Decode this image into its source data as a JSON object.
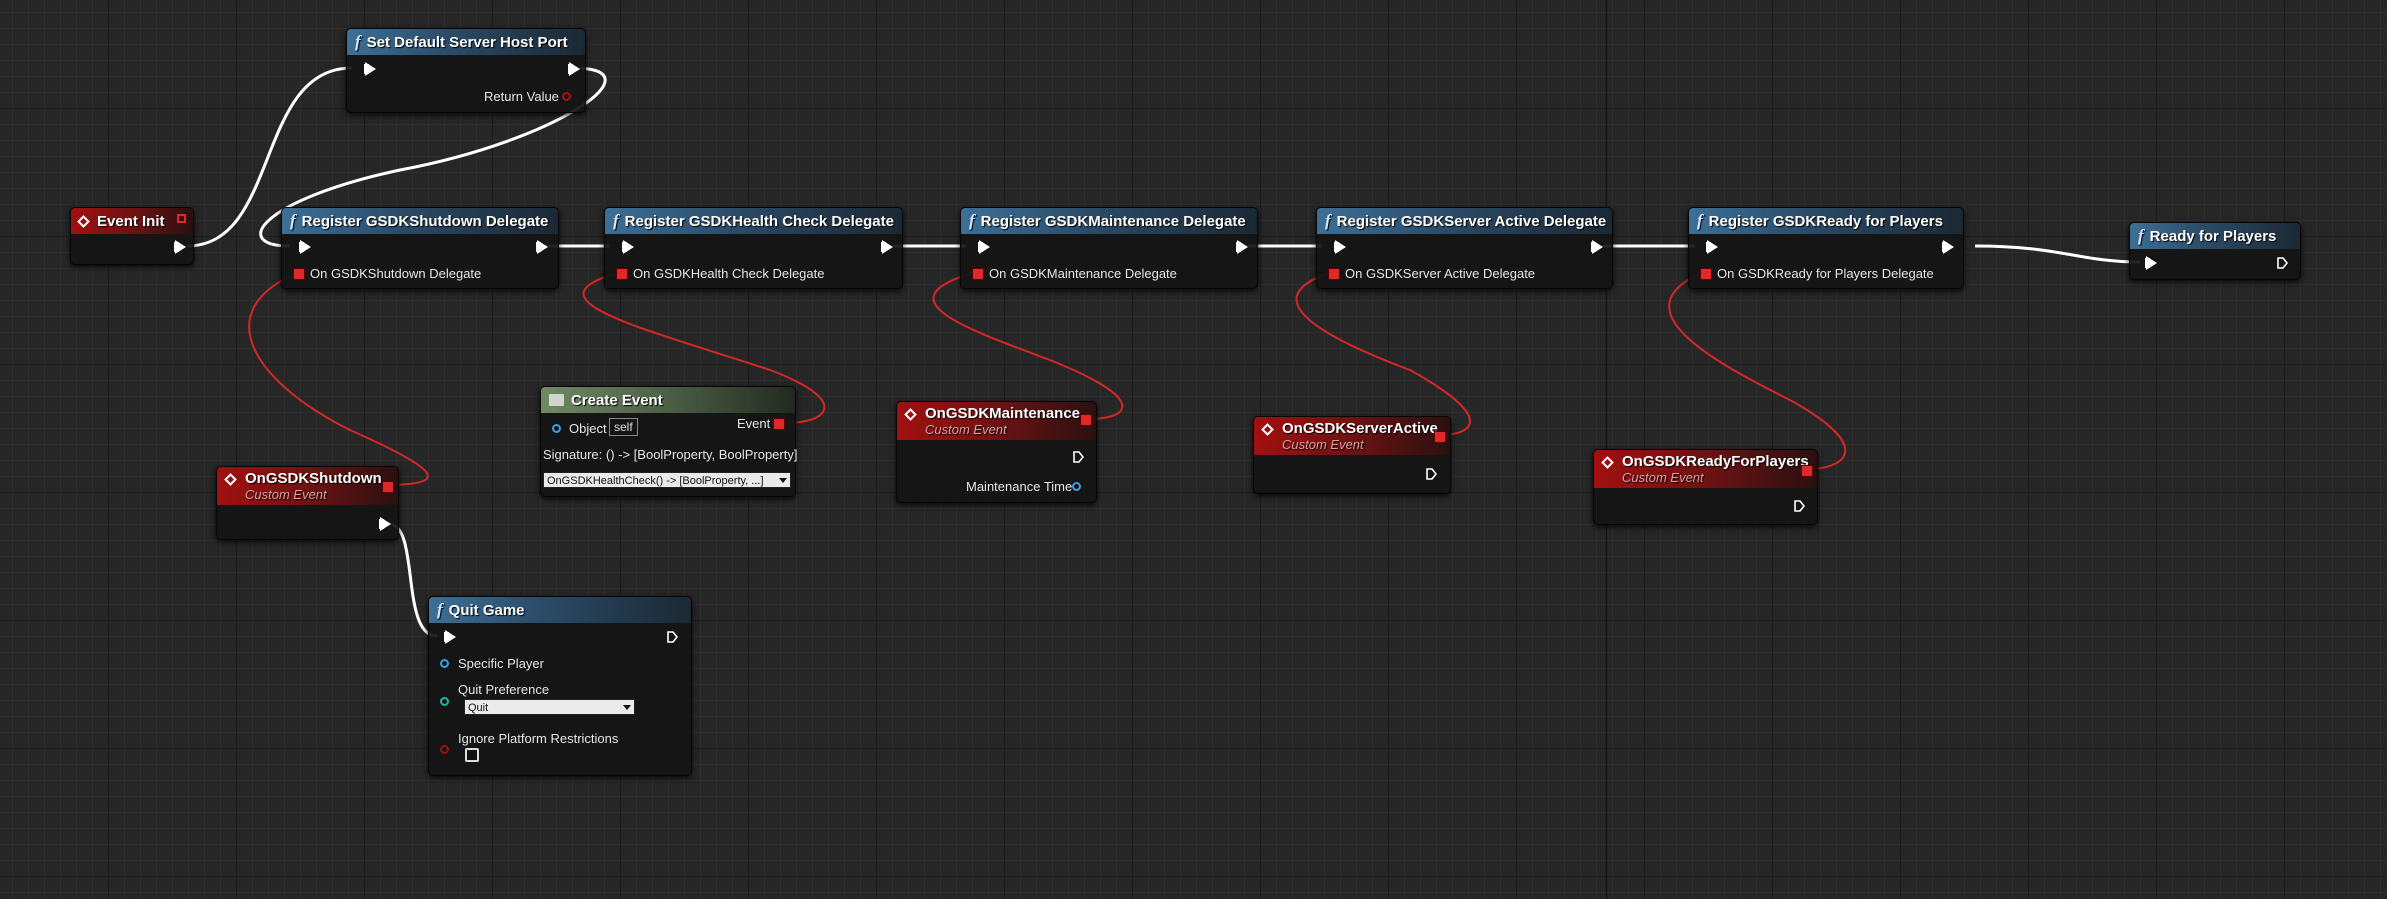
{
  "nodes": {
    "set_port": {
      "icon": "function-icon",
      "title": "Set Default Server Host Port",
      "return_label": "Return Value"
    },
    "event_init": {
      "icon": "event-diamond-icon",
      "title": "Event Init"
    },
    "reg_shutdown": {
      "icon": "function-icon",
      "title": "Register GSDKShutdown Delegate",
      "pin_label": "On GSDKShutdown Delegate"
    },
    "reg_health": {
      "icon": "function-icon",
      "title": "Register GSDKHealth Check Delegate",
      "pin_label": "On GSDKHealth Check Delegate"
    },
    "reg_maint": {
      "icon": "function-icon",
      "title": "Register GSDKMaintenance Delegate",
      "pin_label": "On GSDKMaintenance Delegate"
    },
    "reg_active": {
      "icon": "function-icon",
      "title": "Register GSDKServer Active Delegate",
      "pin_label": "On GSDKServer Active Delegate"
    },
    "reg_ready": {
      "icon": "function-icon",
      "title": "Register GSDKReady for Players",
      "pin_label": "On GSDKReady for Players Delegate"
    },
    "ready_players": {
      "icon": "function-icon",
      "title": "Ready for Players"
    },
    "create_event": {
      "icon": "grid-icon",
      "title": "Create Event",
      "object_label": "Object",
      "self_label": "self",
      "event_label": "Event",
      "signature": "Signature: () -> [BoolProperty, BoolProperty]",
      "selected_function": "OnGSDKHealthCheck() -> [BoolProperty, ...]"
    },
    "on_maint": {
      "icon": "event-diamond-icon",
      "title": "OnGSDKMaintenance",
      "subtitle": "Custom Event",
      "pin_label": "Maintenance Time"
    },
    "on_active": {
      "icon": "event-diamond-icon",
      "title": "OnGSDKServerActive",
      "subtitle": "Custom Event"
    },
    "on_ready": {
      "icon": "event-diamond-icon",
      "title": "OnGSDKReadyForPlayers",
      "subtitle": "Custom Event"
    },
    "on_shutdown": {
      "icon": "event-diamond-icon",
      "title": "OnGSDKShutdown",
      "subtitle": "Custom Event"
    },
    "quit_game": {
      "icon": "function-icon",
      "title": "Quit Game",
      "specific_player": "Specific Player",
      "quit_preference": "Quit Preference",
      "quit_value": "Quit",
      "ignore_label": "Ignore Platform Restrictions",
      "ignore_checked": false
    }
  },
  "colors": {
    "background": "#262626",
    "function_header": "#3d6f96",
    "event_header": "#a11010",
    "create_event_header": "#6f8a64",
    "exec_wire": "#ffffff",
    "delegate_wire": "#d42828",
    "object_pin": "#3ba0e8"
  }
}
